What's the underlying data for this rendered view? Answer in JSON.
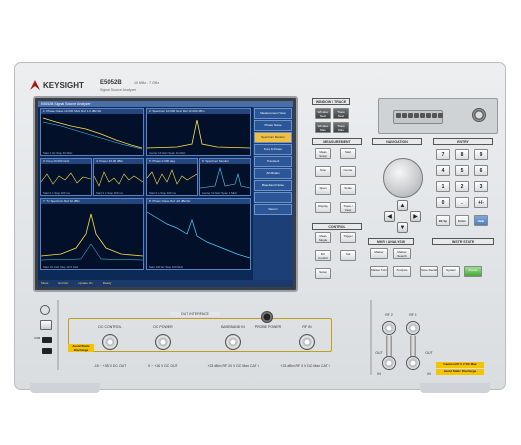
{
  "brand": {
    "name": "KEYSIGHT",
    "model": "E5052B",
    "freq_range": "10 MHz - 7 GHz",
    "subtitle": "Signal Source Analyzer"
  },
  "screen": {
    "title": "E5052B Signal Source Analyzer",
    "windows": [
      {
        "title": "1: Phase Noise  10.000 MHz  Ref 1.0 dBc/Hz",
        "footer": "Start 1 Hz   Stop 40 MHz"
      },
      {
        "title": "2: Spectrum  10.000 GHz  Ref 10.000 dBm",
        "footer": "Center 10 GHz   Span 10 MHz"
      },
      {
        "title": "3: Freq  10.000 GHz",
        "footer": "Start 0 s   Stop 200 ms"
      },
      {
        "title": "4: Power  10.00 dBm",
        "footer": "Start 0 s   Stop 200 ms"
      },
      {
        "title": "5: Phase  0.000 deg",
        "footer": "Start 0 s   Stop 100 ms"
      },
      {
        "title": "6: Spectrum Monitor",
        "footer": "Center 10 GHz   Span 1 MHz"
      },
      {
        "title": "7: Tx Spectrum  Ref 10 dBm",
        "footer": "Start 10 GHz   Stop 10.5 GHz"
      },
      {
        "title": "8: Phase Noise  Ref -20 dBc/Hz",
        "footer": "Start 100 Hz   Stop 100 MHz"
      }
    ],
    "side_buttons": [
      "Measurement View",
      "Phase Noise",
      "Spectrum Monitor",
      "Freq & Power",
      "Transient",
      "All Modes",
      "Baseband Noise",
      "",
      "Return"
    ],
    "status": [
      "Meas",
      "Ext Ref",
      "Update On",
      "Ready"
    ]
  },
  "sections": {
    "window_trace": "WINDOW / TRACE",
    "measurement": "MEASUREMENT",
    "control": "CONTROL",
    "marker_analysis": "MKR / ANALYSIS",
    "navigation": "NAVIGATION",
    "entry": "ENTRY",
    "instr_state": "INSTR STATE",
    "dut_interface": "DUT INTERFACE"
  },
  "window_trace_keys": [
    "Window Next",
    "Trace Next",
    "Window Max",
    "Trace Max"
  ],
  "measurement_keys": [
    "Meas Setup",
    "Start",
    "Stop",
    "Center",
    "Span",
    "Scale",
    "Display",
    "Trace / View",
    "Avg",
    "BW",
    "Avg/BW",
    "Marker",
    "Meas",
    "Setup"
  ],
  "control_keys": [
    "Meas Single",
    "Trigger",
    "DC Control",
    "Cal",
    "Setup"
  ],
  "marker_keys": [
    "Marker",
    "Marker Search",
    "Marker Fctn",
    "Analysis"
  ],
  "entry_keys": [
    "7",
    "8",
    "9",
    "4",
    "5",
    "6",
    "1",
    "2",
    "3",
    "0",
    ".",
    "+/-",
    "Bk Sp",
    "Enter",
    "Help"
  ],
  "instr_keys": [
    "Save Recall",
    "System",
    "Preset"
  ],
  "front_panel": {
    "usb": "USB",
    "ports": [
      {
        "name": "DC CONTROL",
        "spec": "-15 ~ +35 V DC OUT"
      },
      {
        "name": "DC POWER",
        "spec": "0 ~ +16 V DC OUT"
      },
      {
        "name": "BASEBAND IN",
        "spec": "+23 dBm RF  20 V DC  Max  CAT I"
      },
      {
        "name": "PROBE POWER",
        "spec": ""
      },
      {
        "name": "RF IN",
        "spec": "+23 dBm RF  0 V DC  Max  CAT I"
      }
    ],
    "rf_labels": [
      "RF 2",
      "RF 1",
      "OUT",
      "OUT",
      "IN",
      "IN"
    ],
    "caution": "Avoid Static Discharge",
    "caution2": "Caution RF 0 V DC Max",
    "caution3": "Avoid Static Discharge"
  },
  "colors": {
    "screen_bg": "#0b2a57",
    "trace": "#ffe14d",
    "accent": "#f5c400"
  }
}
